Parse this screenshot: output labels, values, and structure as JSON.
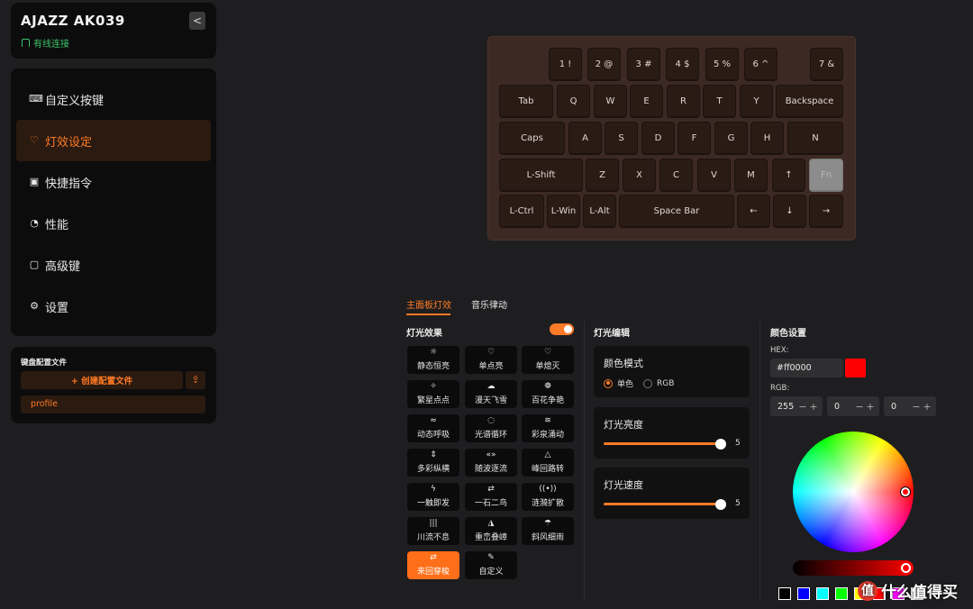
{
  "device": {
    "name": "AJAZZ AK039",
    "status": "有线连接",
    "collapse_glyph": "<"
  },
  "nav": {
    "items": [
      {
        "label": "自定义按键",
        "icon": "keyboard-icon",
        "glyph": "⌨"
      },
      {
        "label": "灯效设定",
        "icon": "bulb-icon",
        "glyph": "♡"
      },
      {
        "label": "快捷指令",
        "icon": "macro-icon",
        "glyph": "▣"
      },
      {
        "label": "性能",
        "icon": "gauge-icon",
        "glyph": "◔"
      },
      {
        "label": "高级键",
        "icon": "advanced-key-icon",
        "glyph": "▢"
      },
      {
        "label": "设置",
        "icon": "gear-icon",
        "glyph": "⚙"
      }
    ],
    "active_index": 1
  },
  "profiles": {
    "title": "键盘配置文件",
    "create_label": "+ 创建配置文件",
    "import_glyph": "⇪",
    "items": [
      "profile"
    ]
  },
  "keyboard": {
    "row1": [
      "1 !",
      "2 @",
      "3 #",
      "4 $",
      "5 %",
      "6 ^",
      "7 &"
    ],
    "row2": [
      "Tab",
      "Q",
      "W",
      "E",
      "R",
      "T",
      "Y",
      "Backspace"
    ],
    "row3": [
      "Caps",
      "A",
      "S",
      "D",
      "F",
      "G",
      "H",
      "N"
    ],
    "row4": [
      "L-Shift",
      "Z",
      "X",
      "C",
      "V",
      "M",
      "↑",
      "Fn"
    ],
    "row5": [
      "L-Ctrl",
      "L-Win",
      "L-Alt",
      "Space Bar",
      "←",
      "↓",
      "→"
    ]
  },
  "tabs": [
    "主面板灯效",
    "音乐律动"
  ],
  "lighting": {
    "title": "灯光效果",
    "enabled": true,
    "effects": [
      {
        "label": "静态恒亮",
        "glyph": "☼"
      },
      {
        "label": "单点亮",
        "glyph": "♡"
      },
      {
        "label": "单熄灭",
        "glyph": "♡"
      },
      {
        "label": "繁星点点",
        "glyph": "✧"
      },
      {
        "label": "漫天飞雪",
        "glyph": "☁"
      },
      {
        "label": "百花争艳",
        "glyph": "❁"
      },
      {
        "label": "动态呼吸",
        "glyph": "≈"
      },
      {
        "label": "光谱循环",
        "glyph": "◌"
      },
      {
        "label": "彩泉涌动",
        "glyph": "≋"
      },
      {
        "label": "多彩纵横",
        "glyph": "⇕"
      },
      {
        "label": "随波逐流",
        "glyph": "«»"
      },
      {
        "label": "峰回路转",
        "glyph": "△"
      },
      {
        "label": "一触即发",
        "glyph": "ϟ"
      },
      {
        "label": "一石二鸟",
        "glyph": "⇄"
      },
      {
        "label": "涟漪扩散",
        "glyph": "((•))"
      },
      {
        "label": "川流不息",
        "glyph": "|||"
      },
      {
        "label": "重峦叠嶂",
        "glyph": "◮"
      },
      {
        "label": "斜风细雨",
        "glyph": "☂"
      },
      {
        "label": "来回穿梭",
        "glyph": "⇄"
      },
      {
        "label": "自定义",
        "glyph": "✎"
      }
    ],
    "active_effect": 18
  },
  "edit": {
    "title": "灯光编辑",
    "color_mode_label": "颜色模式",
    "mode_options": [
      "单色",
      "RGB"
    ],
    "selected_mode": 0,
    "brightness_label": "灯光亮度",
    "brightness": 5,
    "brightness_max": 5,
    "speed_label": "灯光速度",
    "speed": 5,
    "speed_max": 5
  },
  "color": {
    "title": "颜色设置",
    "hex_label": "HEX:",
    "hex_value": "#ff0000",
    "rgb_label": "RGB:",
    "r": "255",
    "g": "0",
    "b": "0",
    "minus_glyph": "−",
    "plus_glyph": "+",
    "current": "#ff0000",
    "presets": [
      "#000000",
      "#0000ff",
      "#00ffff",
      "#00ff00",
      "#ffff00",
      "#ff0000",
      "#ff00ff",
      "#ffffff"
    ]
  },
  "watermark": {
    "logo": "值",
    "text": "什么值得买"
  }
}
